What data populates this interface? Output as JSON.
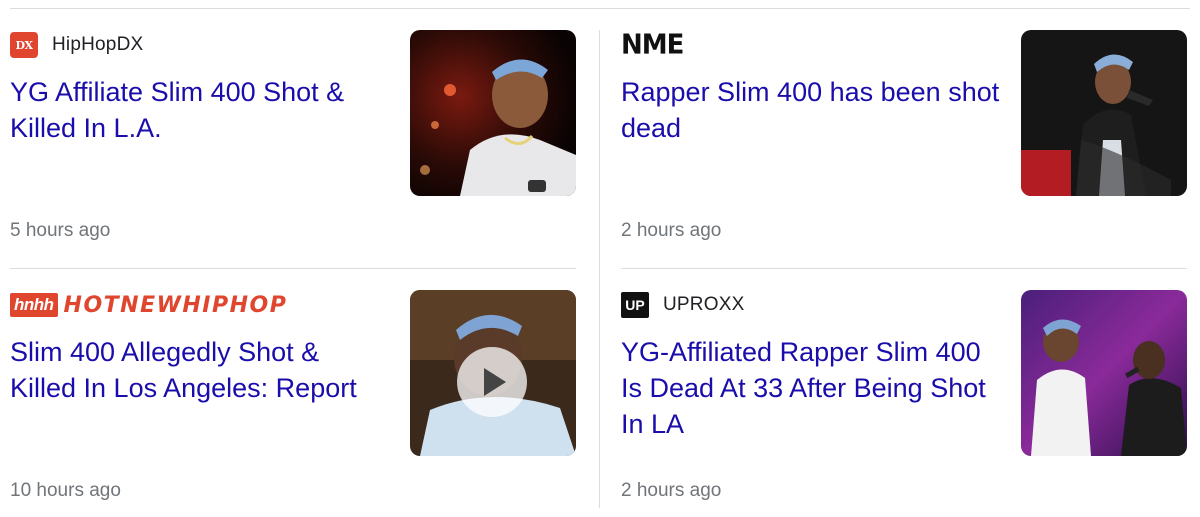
{
  "cards": [
    {
      "source": "HipHopDX",
      "logo_text": "DX",
      "headline": "YG Affiliate Slim 400 Shot & Killed In L.A.",
      "time": "5 hours ago",
      "thumb_icon": "photo-performer-icon",
      "has_video": false
    },
    {
      "source": "",
      "logo_text": "NME",
      "headline": "Rapper Slim 400 has been shot dead",
      "time": "2 hours ago",
      "thumb_icon": "photo-performer-icon",
      "has_video": false
    },
    {
      "source": "",
      "logo_badge": "hnhh",
      "logo_text": "HOTNEWHIPHOP",
      "headline": "Slim 400 Allegedly Shot & Killed In Los Angeles: Report",
      "time": "10 hours ago",
      "thumb_icon": "photo-performer-icon",
      "has_video": true
    },
    {
      "source": "UPROXX",
      "logo_text": "UP",
      "headline": "YG-Affiliated Rapper Slim 400 Is Dead At 33 After Being Shot In LA",
      "time": "2 hours ago",
      "thumb_icon": "photo-performers-icon",
      "has_video": false
    }
  ],
  "colors": {
    "headline": "#1a0dab",
    "meta": "#70757a",
    "divider": "#dadce0",
    "brand_red": "#e0452e"
  }
}
